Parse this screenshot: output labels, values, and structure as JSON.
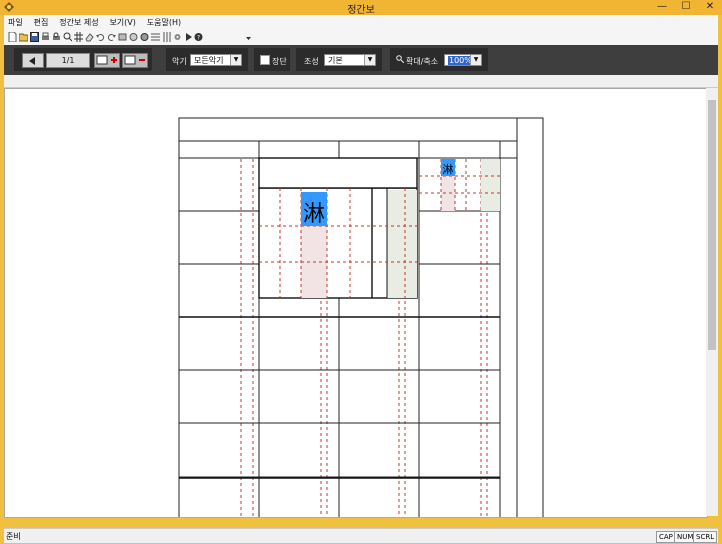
{
  "window": {
    "title": "정간보",
    "minimize": "—",
    "maximize": "☐",
    "close": "✕"
  },
  "menu": [
    {
      "label": "파일"
    },
    {
      "label": "편집"
    },
    {
      "label": "정간보 제성"
    },
    {
      "label": "보기(V)"
    },
    {
      "label": "도움말(H)"
    }
  ],
  "toolbar2": {
    "page_indicator": "1/1",
    "instrument_label": "악기",
    "instrument_value": "모든악기",
    "jangdan_label": "장단",
    "jangdan_checked": false,
    "key_label": "조성",
    "key_value": "기본",
    "zoom_label": "확대/축소",
    "zoom_value": "100%"
  },
  "score": {
    "glyph_large": "淋",
    "glyph_small": "淋",
    "highlight_color": "#3399ff",
    "guide_color": "#c0392b"
  },
  "status": {
    "text": "준비",
    "cap": "CAP",
    "num": "NUM",
    "scrl": "SCRL"
  }
}
